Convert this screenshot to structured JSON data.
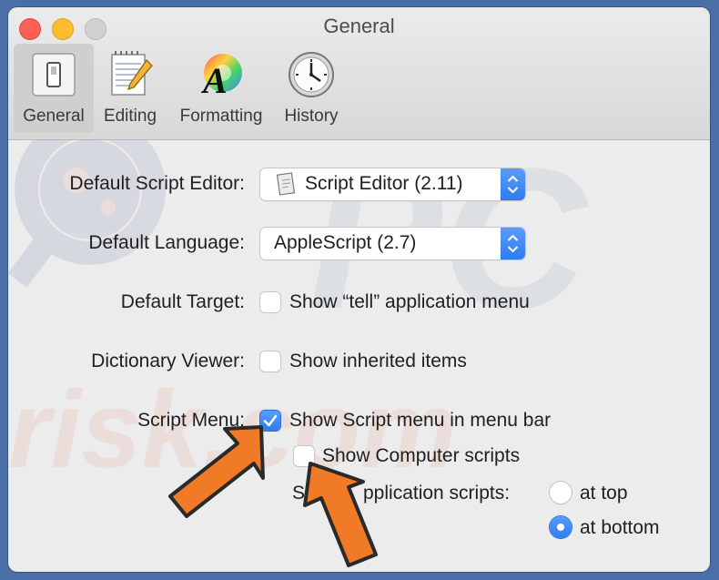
{
  "window": {
    "title": "General"
  },
  "toolbar": {
    "tabs": [
      {
        "label": "General",
        "icon": "switch-icon",
        "selected": true
      },
      {
        "label": "Editing",
        "icon": "notepad-pencil-icon",
        "selected": false
      },
      {
        "label": "Formatting",
        "icon": "font-color-wheel-icon",
        "selected": false
      },
      {
        "label": "History",
        "icon": "clock-icon",
        "selected": false
      }
    ]
  },
  "settings": {
    "default_script_editor": {
      "label": "Default Script Editor:",
      "value": "Script Editor (2.11)"
    },
    "default_language": {
      "label": "Default Language:",
      "value": "AppleScript (2.7)"
    },
    "default_target": {
      "label": "Default Target:",
      "checkbox_label": "Show “tell” application menu",
      "checked": false
    },
    "dictionary_viewer": {
      "label": "Dictionary Viewer:",
      "checkbox_label": "Show inherited items",
      "checked": false
    },
    "script_menu": {
      "label": "Script Menu:",
      "show_in_menu_bar": {
        "label": "Show Script menu in menu bar",
        "checked": true
      },
      "show_computer_scripts": {
        "label": "Show Computer scripts",
        "checked": false
      },
      "app_scripts": {
        "label_visible": "S",
        "label_visible_tail": "pplication scripts:",
        "options": [
          {
            "label": "at top",
            "selected": false
          },
          {
            "label": "at bottom",
            "selected": true
          }
        ]
      }
    }
  },
  "colors": {
    "accent": "#2f7cf0",
    "arrow": "#f07a26",
    "watermark": "#e8643a"
  },
  "watermark": {
    "text": "risk.com"
  }
}
